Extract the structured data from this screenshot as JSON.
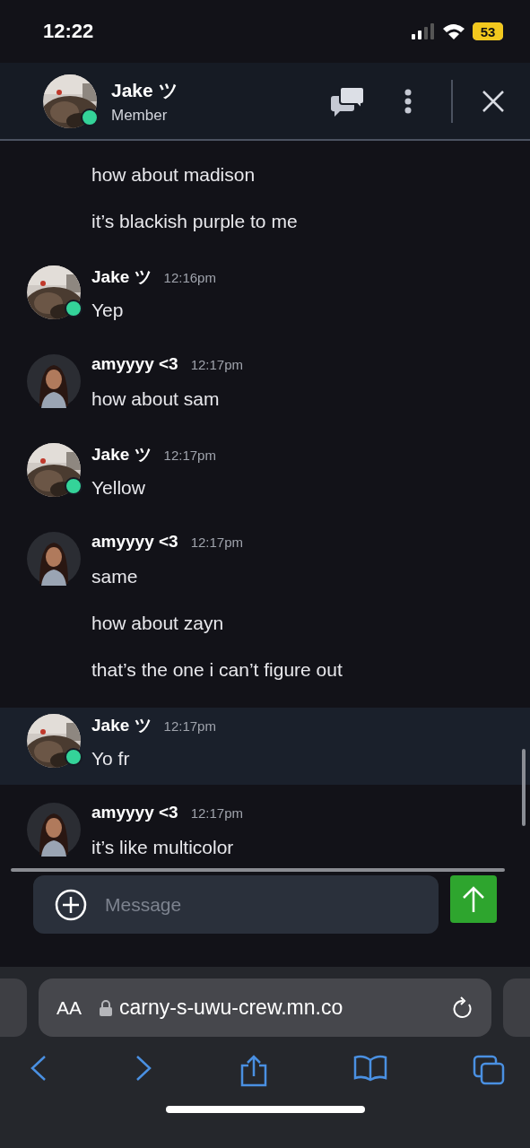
{
  "status_bar": {
    "time": "12:22",
    "battery": "53"
  },
  "header": {
    "name": "Jake ツ",
    "role": "Member",
    "online": true
  },
  "messages": [
    {
      "kind": "continuation",
      "highlighted": false,
      "texts": [
        "how about madison",
        "it’s blackish purple to me"
      ]
    },
    {
      "author": "Jake ツ",
      "time": "12:16pm",
      "online": true,
      "highlighted": false,
      "texts": [
        "Yep"
      ]
    },
    {
      "kind": "silhouette",
      "author": "amyyyy <3",
      "time": "12:17pm",
      "online": false,
      "highlighted": false,
      "texts": [
        "how about sam"
      ]
    },
    {
      "author": "Jake ツ",
      "time": "12:17pm",
      "online": true,
      "highlighted": false,
      "texts": [
        "Yellow"
      ]
    },
    {
      "kind": "silhouette",
      "author": "amyyyy <3",
      "time": "12:17pm",
      "online": false,
      "highlighted": false,
      "texts": [
        "same",
        "how about zayn",
        "that’s the one i can’t figure out"
      ]
    },
    {
      "author": "Jake ツ",
      "time": "12:17pm",
      "online": true,
      "highlighted": true,
      "texts": [
        "Yo fr"
      ]
    },
    {
      "kind": "silhouette",
      "author": "amyyyy <3",
      "time": "12:17pm",
      "online": false,
      "highlighted": false,
      "texts": [
        "it’s like multicolor"
      ]
    }
  ],
  "composer": {
    "placeholder": "Message"
  },
  "browser": {
    "text_size": "AA",
    "url": "carny-s-uwu-crew.mn.co"
  }
}
